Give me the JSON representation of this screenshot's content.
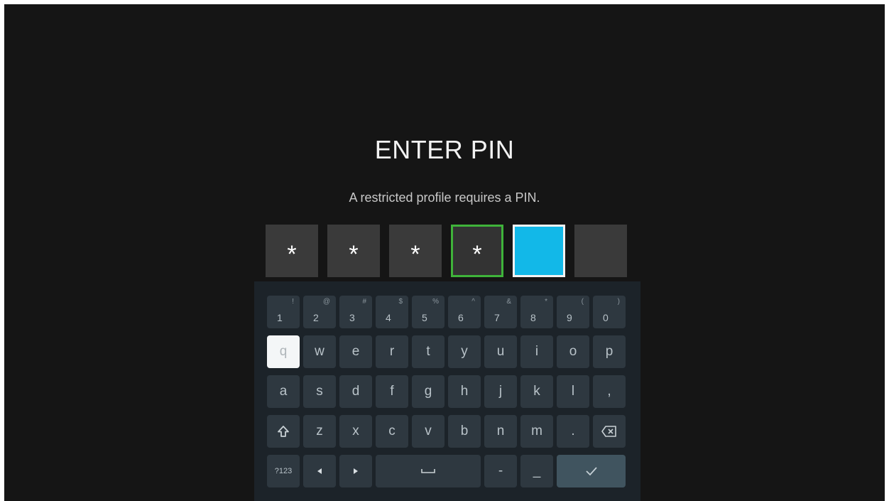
{
  "dialog": {
    "title": "ENTER PIN",
    "subtitle": "A restricted profile requires a PIN."
  },
  "pin": {
    "digits": [
      "*",
      "*",
      "*",
      "*",
      "",
      ""
    ],
    "length": 6,
    "entered": 4
  },
  "keyboard": {
    "numbers": [
      {
        "key": "1",
        "alt": "!"
      },
      {
        "key": "2",
        "alt": "@"
      },
      {
        "key": "3",
        "alt": "#"
      },
      {
        "key": "4",
        "alt": "$"
      },
      {
        "key": "5",
        "alt": "%"
      },
      {
        "key": "6",
        "alt": "^"
      },
      {
        "key": "7",
        "alt": "&"
      },
      {
        "key": "8",
        "alt": "*"
      },
      {
        "key": "9",
        "alt": "("
      },
      {
        "key": "0",
        "alt": ")"
      }
    ],
    "row1": [
      "q",
      "w",
      "e",
      "r",
      "t",
      "y",
      "u",
      "i",
      "o",
      "p"
    ],
    "row2": [
      "a",
      "s",
      "d",
      "f",
      "g",
      "h",
      "j",
      "k",
      "l",
      ","
    ],
    "row3": [
      "z",
      "x",
      "c",
      "v",
      "b",
      "n",
      "m",
      "."
    ],
    "row4": {
      "symbols_label": "?123",
      "dash": "-",
      "underscore": "_"
    },
    "selected_key": "q"
  },
  "colors": {
    "background": "#151515",
    "pin_box": "#3a3a3a",
    "pin_active": "#12b8e8",
    "pin_last_border": "#3fb33a",
    "keyboard_bg": "#1c2329",
    "key_bg": "#2e3840",
    "enter_key_bg": "#40545f"
  },
  "icons": {
    "shift": "shift-icon",
    "backspace": "backspace-icon",
    "left": "arrow-left-icon",
    "right": "arrow-right-icon",
    "space": "space-icon",
    "enter": "checkmark-icon"
  }
}
